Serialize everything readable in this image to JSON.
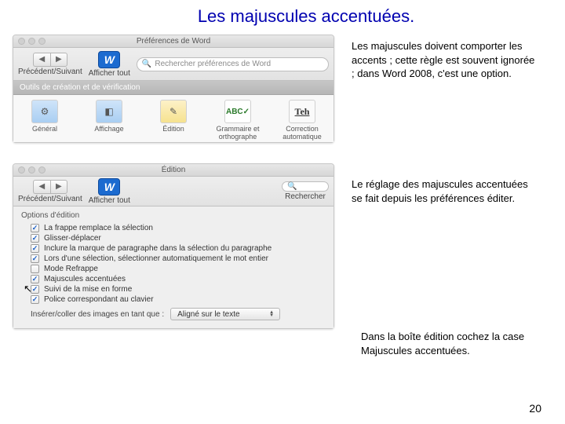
{
  "title": "Les majuscules accentuées.",
  "paragraphs": {
    "p1": "Les majuscules doivent comporter les accents ; cette règle est souvent ignorée ; dans Word 2008, c'est une option.",
    "p2": "Le réglage des majuscules accentuées se fait depuis les préférences éditer.",
    "p3": "Dans la boîte édition cochez la case Majuscules accentuées."
  },
  "page_number": "20",
  "win1": {
    "titlebar": "Préférences de Word",
    "nav_label": "Précédent/Suivant",
    "show_all": "Afficher tout",
    "search_placeholder": "Rechercher préférences de Word",
    "section": "Outils de création et de vérification",
    "items": [
      {
        "label": "Général"
      },
      {
        "label": "Affichage"
      },
      {
        "label": "Édition"
      },
      {
        "label": "Grammaire et orthographe"
      },
      {
        "label": "Correction automatique"
      }
    ],
    "icons": {
      "w": "W",
      "abc": "ABC✓",
      "teh": "Teh"
    }
  },
  "win2": {
    "titlebar": "Édition",
    "nav_label": "Précédent/Suivant",
    "show_all": "Afficher tout",
    "search_label": "Rechercher",
    "options_title": "Options d'édition",
    "options": [
      {
        "checked": true,
        "label": "La frappe remplace la sélection"
      },
      {
        "checked": true,
        "label": "Glisser-déplacer"
      },
      {
        "checked": true,
        "label": "Inclure la marque de paragraphe dans la sélection du paragraphe"
      },
      {
        "checked": true,
        "label": "Lors d'une sélection, sélectionner automatiquement le mot entier"
      },
      {
        "checked": false,
        "label": "Mode Refrappe"
      },
      {
        "checked": true,
        "label": "Majuscules accentuées"
      },
      {
        "checked": true,
        "label": "Suivi de la mise en forme"
      },
      {
        "checked": true,
        "label": "Police correspondant au clavier"
      }
    ],
    "insert_label": "Insérer/coller des images en tant que :",
    "insert_value": "Aligné sur le texte"
  }
}
